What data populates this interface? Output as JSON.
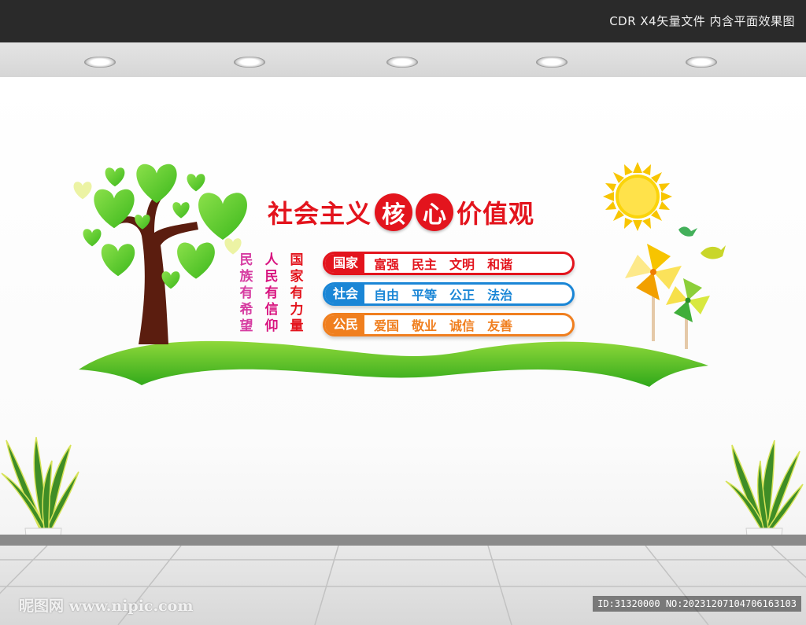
{
  "header": {
    "caption": "CDR X4矢量文件  内含平面效果图"
  },
  "title": {
    "prefix": "社会主义",
    "circle1": "核",
    "circle2": "心",
    "suffix": "价值观",
    "color": "#e3141d"
  },
  "vertical_slogans": [
    {
      "text": "国家有力量",
      "color": "#e3141d"
    },
    {
      "text": "人民有信仰",
      "color": "#d8137f"
    },
    {
      "text": "民族有希望",
      "color": "#d63ca1"
    }
  ],
  "value_rows": [
    {
      "label": "国家",
      "items": [
        "富强",
        "民主",
        "文明",
        "和谐"
      ],
      "color": "#e3141d"
    },
    {
      "label": "社会",
      "items": [
        "自由",
        "平等",
        "公正",
        "法治"
      ],
      "color": "#1a86d6"
    },
    {
      "label": "公民",
      "items": [
        "爱国",
        "敬业",
        "诚信",
        "友善"
      ],
      "color": "#f07f1f"
    }
  ],
  "watermark": {
    "left": "昵图网 www.nipic.com",
    "right": "ID:31320000 NO:20231207104706163103"
  },
  "colors": {
    "grass": "#56c21e",
    "tree_trunk": "#5b1d0f",
    "leaf": "#5ac92a",
    "sun": "#f8c500"
  },
  "icons": [
    "ceiling-lamp-icon",
    "tree-icon",
    "sun-icon",
    "pinwheel-icon",
    "bird-icon",
    "potted-plant-icon"
  ]
}
